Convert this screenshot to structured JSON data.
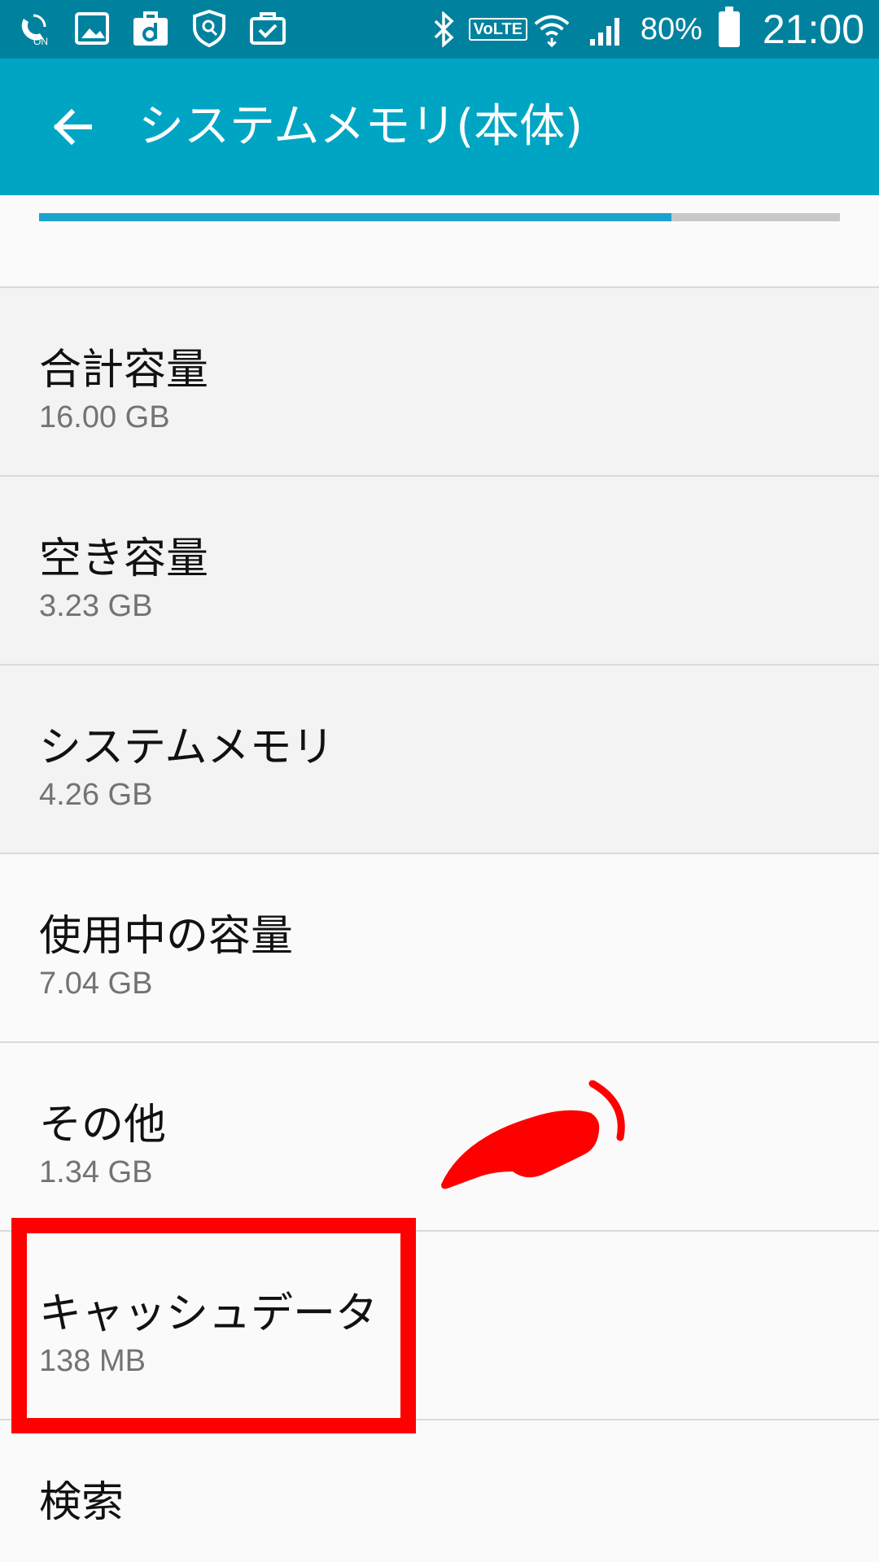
{
  "status_bar": {
    "battery": "80%",
    "time": "21:00",
    "volte": "VoLTE",
    "icons": [
      "wifi-calling-on-icon",
      "gallery-icon",
      "docomo-d-icon",
      "security-shield-icon",
      "briefcase-check-icon",
      "bluetooth-icon",
      "volte-icon",
      "wifi-icon",
      "signal-icon",
      "battery-icon"
    ]
  },
  "app_bar": {
    "title": "システムメモリ(本体)",
    "back_icon": "arrow-back-icon"
  },
  "storage_bar": {
    "used_fraction": 0.79,
    "fill_color": "#1ba3cf",
    "track_color": "#c8c8c8"
  },
  "items": [
    {
      "title": "合計容量",
      "value": "16.00 GB"
    },
    {
      "title": "空き容量",
      "value": "3.23 GB"
    },
    {
      "title": "システムメモリ",
      "value": "4.26 GB"
    },
    {
      "title": "使用中の容量",
      "value": "7.04 GB"
    },
    {
      "title": "その他",
      "value": "1.34 GB"
    },
    {
      "title": "キャッシュデータ",
      "value": "138 MB"
    },
    {
      "title": "検索"
    }
  ],
  "colors": {
    "status_bar": "#00829f",
    "app_bar": "#00a5c4",
    "annotation": "#ff0000"
  }
}
